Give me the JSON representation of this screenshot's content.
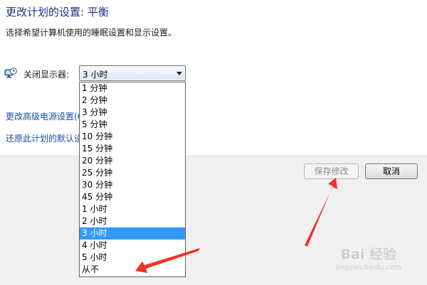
{
  "header": {
    "title": "更改计划的设置: 平衡",
    "subtitle": "选择希望计算机使用的睡眠设置和显示设置。"
  },
  "settings": {
    "display_off": {
      "icon": "monitor-clock-icon",
      "label": "关闭显示器:",
      "selected": "3 小时",
      "options": [
        "1 分钟",
        "2 分钟",
        "3 分钟",
        "5 分钟",
        "10 分钟",
        "15 分钟",
        "20 分钟",
        "25 分钟",
        "30 分钟",
        "45 分钟",
        "1 小时",
        "2 小时",
        "3 小时",
        "4 小时",
        "5 小时",
        "从不"
      ],
      "highlighted_index": 12
    }
  },
  "links": {
    "advanced": "更改高级电源设置(C)",
    "restore": "还原此计划的默认设置"
  },
  "buttons": {
    "save": "保存修改",
    "cancel": "取消"
  },
  "annotation": {
    "arrow_color": "#f03226"
  },
  "watermark": {
    "logo": "Bai 经验",
    "url": "jingyan.baidu.com"
  },
  "colors": {
    "title": "#1e3287",
    "link": "#1a4fa3",
    "selection": "#3399ff"
  }
}
